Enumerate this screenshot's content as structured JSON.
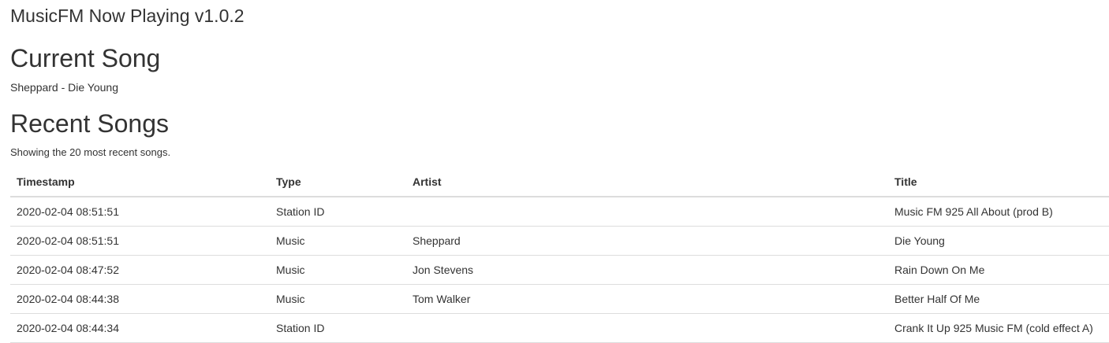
{
  "app": {
    "title": "MusicFM Now Playing v1.0.2"
  },
  "current": {
    "heading": "Current Song",
    "song": "Sheppard - Die Young"
  },
  "recent": {
    "heading": "Recent Songs",
    "note": "Showing the 20 most recent songs.",
    "columns": [
      "Timestamp",
      "Type",
      "Artist",
      "Title"
    ],
    "rows": [
      {
        "timestamp": "2020-02-04 08:51:51",
        "type": "Station ID",
        "artist": "",
        "title": "Music FM 925 All About (prod B)"
      },
      {
        "timestamp": "2020-02-04 08:51:51",
        "type": "Music",
        "artist": "Sheppard",
        "title": "Die Young"
      },
      {
        "timestamp": "2020-02-04 08:47:52",
        "type": "Music",
        "artist": "Jon Stevens",
        "title": "Rain Down On Me"
      },
      {
        "timestamp": "2020-02-04 08:44:38",
        "type": "Music",
        "artist": "Tom Walker",
        "title": "Better Half Of Me"
      },
      {
        "timestamp": "2020-02-04 08:44:34",
        "type": "Station ID",
        "artist": "",
        "title": "Crank It Up 925 Music FM (cold effect A)"
      }
    ]
  }
}
